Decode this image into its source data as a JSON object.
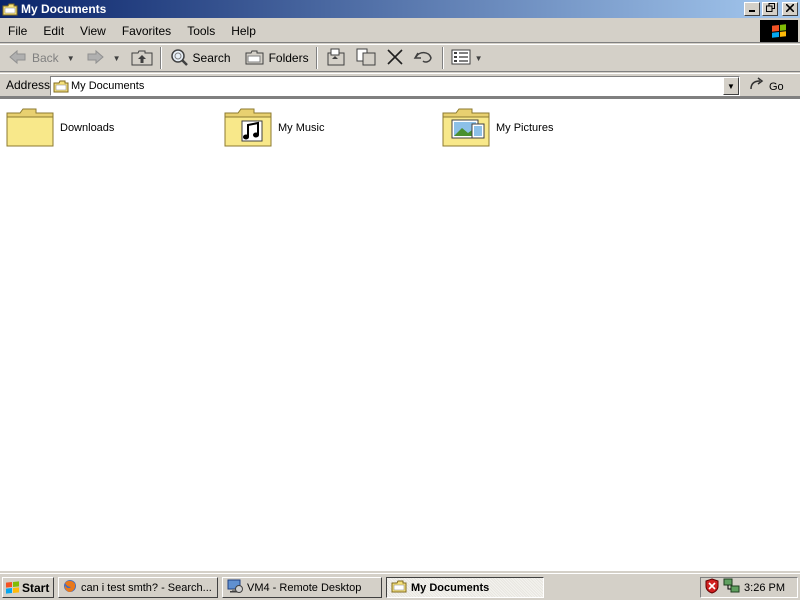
{
  "window": {
    "title": "My Documents"
  },
  "menu": [
    "File",
    "Edit",
    "View",
    "Favorites",
    "Tools",
    "Help"
  ],
  "toolbar": {
    "back_label": "Back",
    "search_label": "Search",
    "folders_label": "Folders"
  },
  "address": {
    "label": "Address",
    "value": "My Documents",
    "go_label": "Go"
  },
  "files": [
    {
      "name": "Downloads",
      "icon": "folder-icon"
    },
    {
      "name": "My Music",
      "icon": "music-folder-icon"
    },
    {
      "name": "My Pictures",
      "icon": "pictures-folder-icon"
    }
  ],
  "taskbar": {
    "start_label": "Start",
    "tasks": [
      {
        "label": "can i test smth? - Search...",
        "icon": "firefox-icon"
      },
      {
        "label": "VM4 - Remote Desktop",
        "icon": "remote-desktop-icon"
      },
      {
        "label": "My Documents",
        "icon": "folder-icon",
        "active": true
      }
    ],
    "clock": "3:26 PM"
  },
  "colors": {
    "titlebar_start": "#0a246a",
    "titlebar_end": "#a6caf0",
    "chrome": "#d4d0c8",
    "folder": "#f5e07a"
  }
}
